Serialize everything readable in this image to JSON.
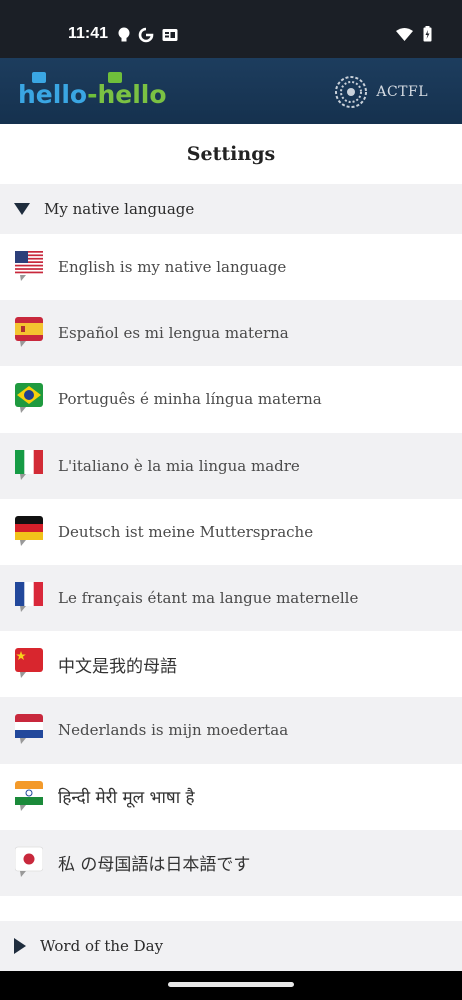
{
  "status_bar": {
    "time": "11:41"
  },
  "header": {
    "logo_part1": "hello",
    "logo_dash": "-",
    "logo_part2": "hello",
    "partner": "ACTFL"
  },
  "page": {
    "title": "Settings"
  },
  "native_section": {
    "label": "My native language",
    "expanded": true
  },
  "languages": [
    {
      "label": "English is my native language",
      "flag": "us"
    },
    {
      "label": "Español es mi lengua materna",
      "flag": "es"
    },
    {
      "label": "Português é minha língua materna",
      "flag": "br"
    },
    {
      "label": "L'italiano è la mia lingua madre",
      "flag": "it"
    },
    {
      "label": "Deutsch ist meine Muttersprache",
      "flag": "de"
    },
    {
      "label": "Le français étant ma langue maternelle",
      "flag": "fr"
    },
    {
      "label": "中文是我的母語",
      "flag": "cn"
    },
    {
      "label": "Nederlands is mijn moedertaa",
      "flag": "nl"
    },
    {
      "label": "हिन्दी मेरी मूल भाषा है",
      "flag": "in"
    },
    {
      "label": "私 の母国語は日本語です",
      "flag": "jp"
    }
  ],
  "wotd_section": {
    "label": "Word of the Day",
    "expanded": false
  },
  "colors": {
    "header_bg": "#1d3d5e",
    "accent_blue": "#3aa6e3",
    "accent_green": "#7ac143",
    "row_alt": "#f1f1f3"
  }
}
